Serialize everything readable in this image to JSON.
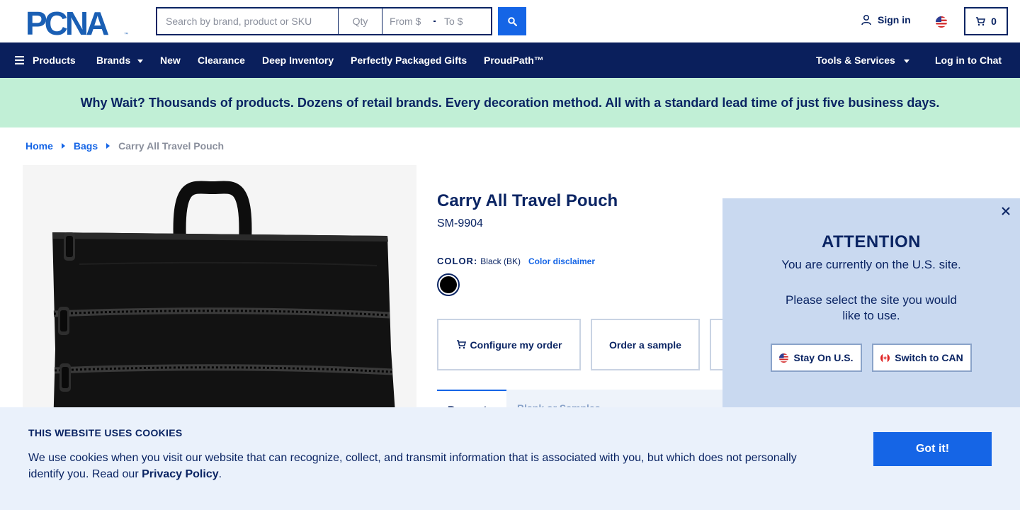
{
  "header": {
    "logo_text": "PCNA",
    "search": {
      "placeholder": "Search by brand, product or SKU",
      "qty_placeholder": "Qty",
      "from_placeholder": "From $",
      "to_placeholder": "To $"
    },
    "signin_label": "Sign in",
    "cart_count": "0"
  },
  "nav": {
    "items": [
      {
        "label": "Products"
      },
      {
        "label": "Brands"
      },
      {
        "label": "New"
      },
      {
        "label": "Clearance"
      },
      {
        "label": "Deep Inventory"
      },
      {
        "label": "Perfectly Packaged Gifts"
      },
      {
        "label": "ProudPath™"
      },
      {
        "label": "Tools & Services"
      },
      {
        "label": "Log in to Chat"
      }
    ]
  },
  "promo": {
    "text": "Why Wait? Thousands of products. Dozens of retail brands. Every decoration method. All with a standard lead time of just five business days."
  },
  "breadcrumb": {
    "items": [
      "Home",
      "Bags"
    ],
    "current": "Carry All Travel Pouch"
  },
  "product": {
    "title": "Carry All Travel Pouch",
    "sku": "SM-9904",
    "color_label": "COLOR:",
    "color_value": "Black (BK)",
    "color_disclaimer": "Color disclaimer",
    "swatch_color": "#000000",
    "actions": {
      "configure": "Configure my order",
      "sample": "Order a sample"
    },
    "tabs": {
      "active": "Request",
      "inactive": "Blank or Samples"
    }
  },
  "attention": {
    "title": "ATTENTION",
    "line1": "You are currently on the U.S. site.",
    "line2": "Please select the site you would like to use.",
    "stay_label": "Stay On U.S.",
    "switch_label": "Switch to CAN"
  },
  "cookies": {
    "title": "THIS WEBSITE USES COOKIES",
    "text": "We use cookies when you visit our website that can recognize, collect, and transmit information that is associated with you, but which does not personally identify you. Read our ",
    "link": "Privacy Policy",
    "end": ".",
    "button": "Got it!"
  },
  "colors": {
    "navy": "#0a1f5c",
    "accent_blue": "#1565e6",
    "promo_green": "#c1efd6",
    "popup_bg": "#c9d9f0",
    "cookie_bg": "#eaf1fb"
  }
}
